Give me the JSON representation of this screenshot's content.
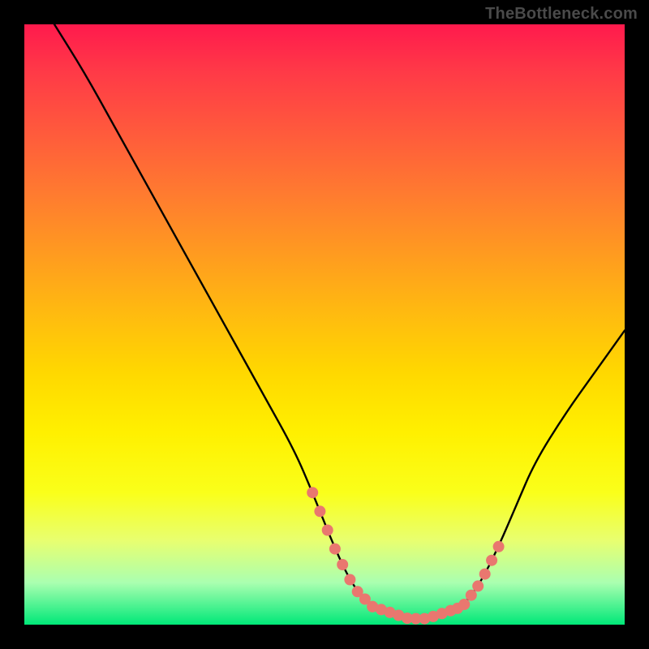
{
  "watermark": {
    "text": "TheBottleneck.com"
  },
  "chart_data": {
    "type": "line",
    "title": "",
    "xlabel": "",
    "ylabel": "",
    "xlim": [
      0,
      100
    ],
    "ylim": [
      0,
      100
    ],
    "series": [
      {
        "name": "curve",
        "x": [
          5,
          10,
          15,
          20,
          25,
          30,
          35,
          40,
          45,
          48,
          52,
          55,
          58,
          61,
          64,
          67,
          70,
          73,
          76,
          79,
          82,
          85,
          90,
          95,
          100
        ],
        "y": [
          100,
          92,
          83,
          74,
          65,
          56,
          47,
          38,
          29,
          22,
          12,
          6,
          3,
          2,
          1,
          1,
          2,
          3,
          7,
          13,
          20,
          27,
          35,
          42,
          49
        ]
      }
    ],
    "marker_zones": [
      {
        "name": "left-dots",
        "x_range": [
          48,
          58
        ],
        "count": 9,
        "side": "descending"
      },
      {
        "name": "floor-dots",
        "x_range": [
          58,
          71
        ],
        "count": 10,
        "side": "valley"
      },
      {
        "name": "right-dots",
        "x_range": [
          71,
          79
        ],
        "count": 8,
        "side": "ascending"
      }
    ],
    "background_gradient": {
      "top": "#ff1a4d",
      "bottom": "#00e878",
      "direction": "vertical"
    }
  }
}
